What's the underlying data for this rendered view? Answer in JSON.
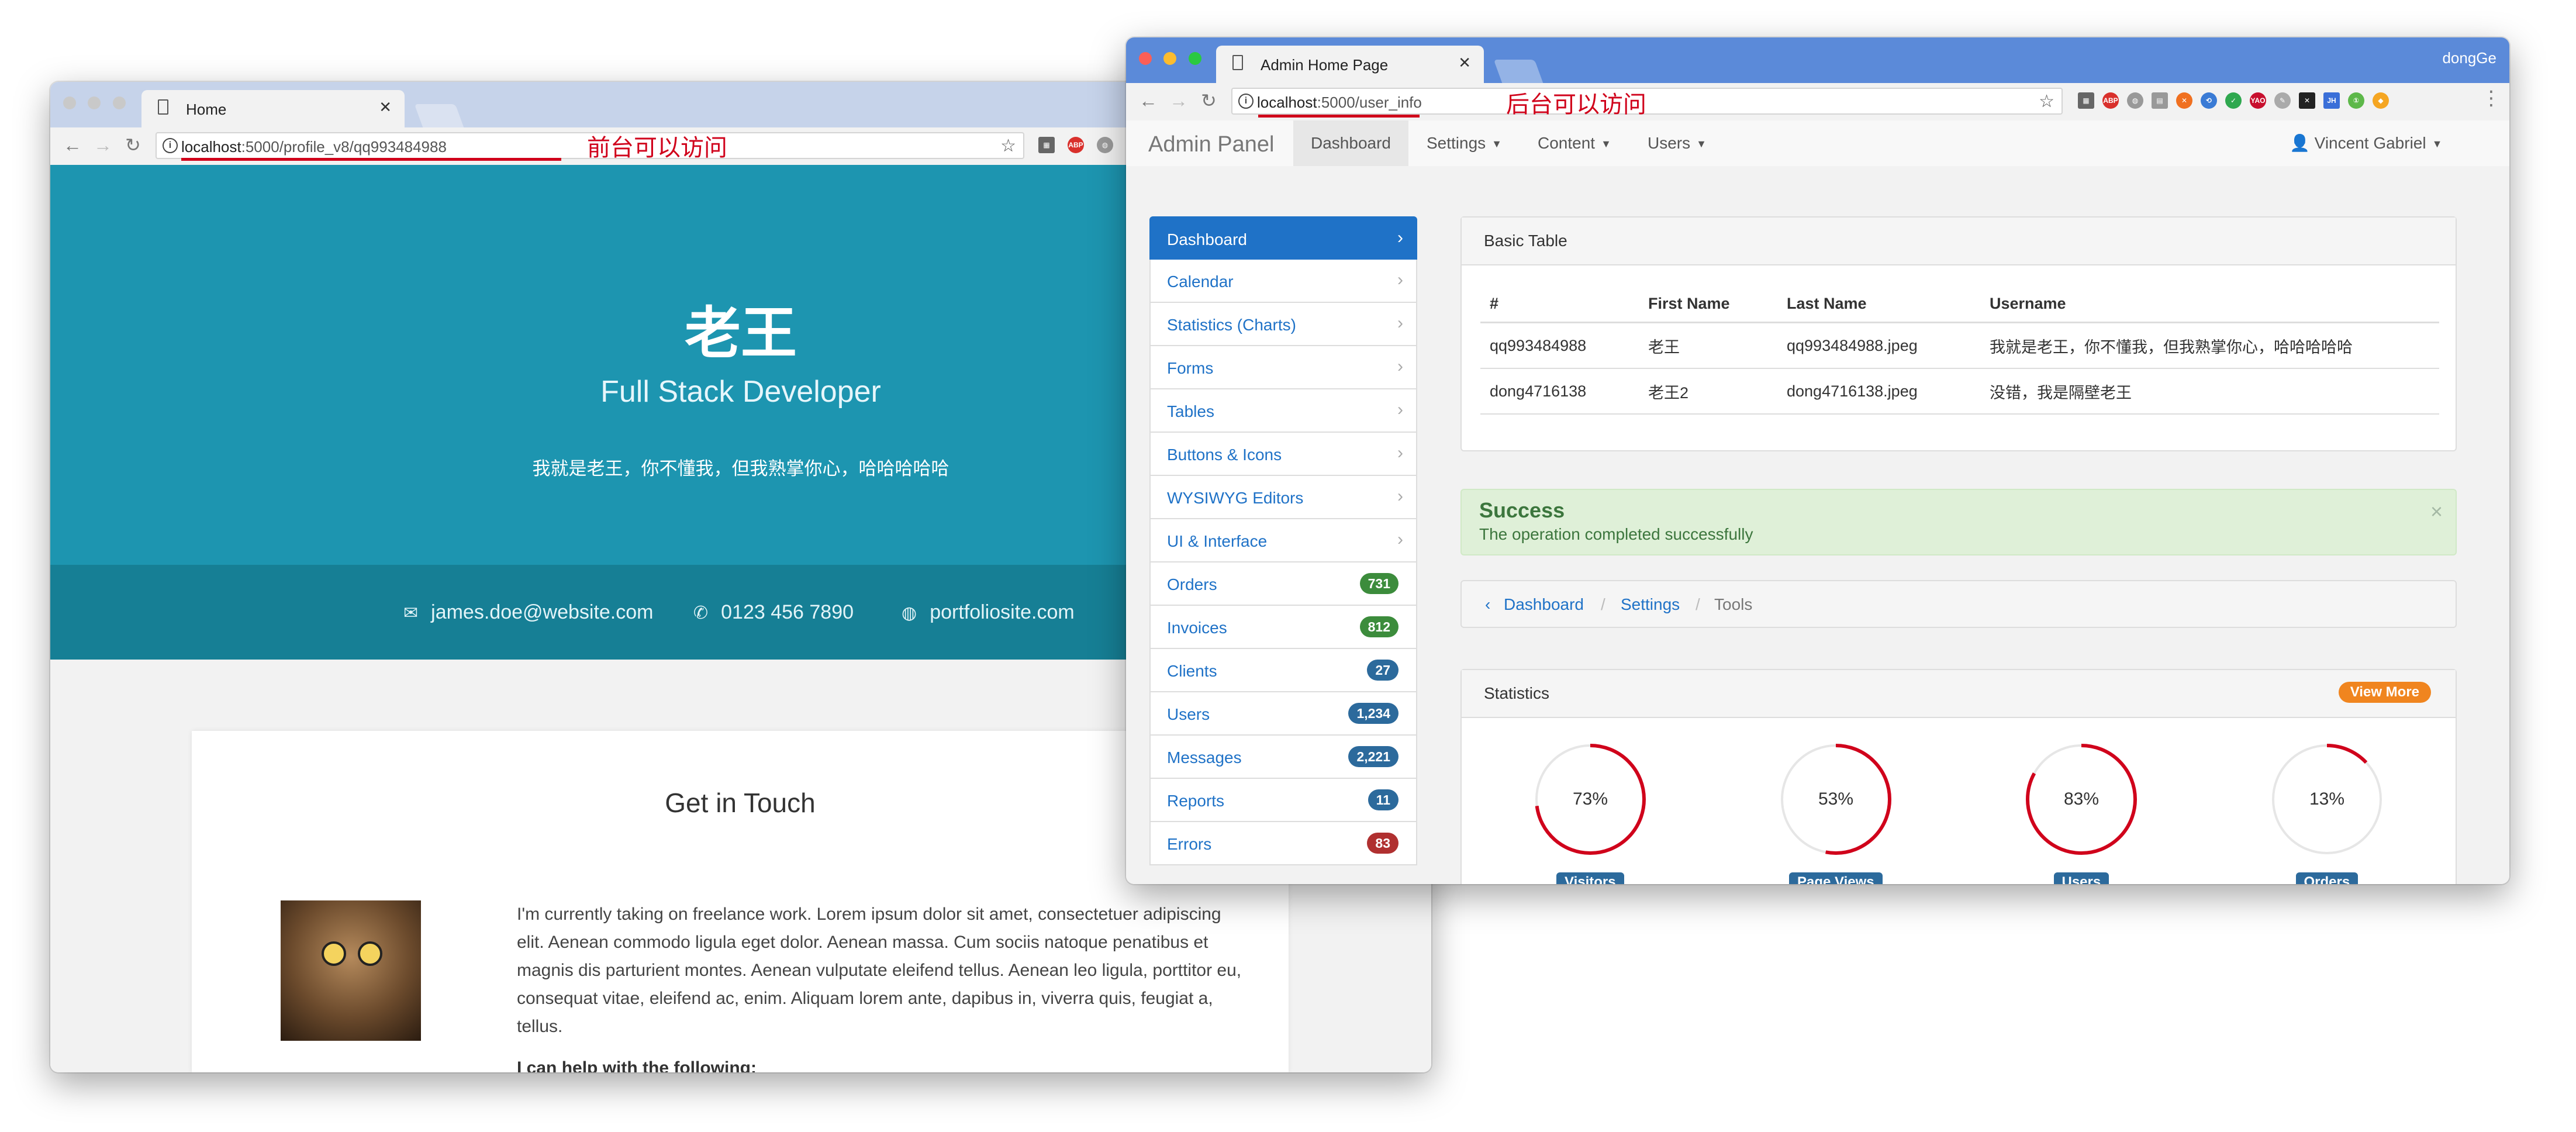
{
  "home_window": {
    "tab_title": "Home",
    "url_host": "localhost",
    "url_path": ":5000/profile_v8/qq993484988",
    "annotation": "前台可以访问",
    "hero": {
      "name": "老王",
      "role": "Full Stack Developer",
      "bio": "我就是老王，你不懂我，但我熟掌你心，哈哈哈哈哈"
    },
    "contact": {
      "email": "james.doe@website.com",
      "phone": "0123 456 7890",
      "site": "portfoliosite.com"
    },
    "touch": {
      "title": "Get in Touch",
      "paragraph": "I'm currently taking on freelance work. Lorem ipsum dolor sit amet, consectetuer adipiscing elit. Aenean commodo ligula eget dolor. Aenean massa. Cum sociis natoque penatibus et magnis dis parturient montes. Aenean vulputate eleifend tellus. Aenean leo ligula, porttitor eu, consequat vitae, eleifend ac, enim. Aliquam lorem ante, dapibus in, viverra quis, feugiat a, tellus.",
      "help_heading": "I can help with the following:"
    }
  },
  "admin_window": {
    "tab_title": "Admin Home Page",
    "profile_name": "dongGe",
    "url_host": "localhost",
    "url_path": ":5000/user_info",
    "annotation": "后台可以访问",
    "navbar": {
      "brand": "Admin Panel",
      "items": [
        "Dashboard",
        "Settings",
        "Content",
        "Users"
      ],
      "user": "Vincent Gabriel"
    },
    "sidebar": [
      {
        "label": "Dashboard",
        "active": true
      },
      {
        "label": "Calendar"
      },
      {
        "label": "Statistics (Charts)"
      },
      {
        "label": "Forms"
      },
      {
        "label": "Tables"
      },
      {
        "label": "Buttons & Icons"
      },
      {
        "label": "WYSIWYG Editors"
      },
      {
        "label": "UI & Interface"
      },
      {
        "label": "Orders",
        "badge": "731",
        "badge_color": "#3c8c3c"
      },
      {
        "label": "Invoices",
        "badge": "812",
        "badge_color": "#3c8c3c"
      },
      {
        "label": "Clients",
        "badge": "27",
        "badge_color": "#2c6a9c"
      },
      {
        "label": "Users",
        "badge": "1,234",
        "badge_color": "#2c6a9c"
      },
      {
        "label": "Messages",
        "badge": "2,221",
        "badge_color": "#2c6a9c"
      },
      {
        "label": "Reports",
        "badge": "11",
        "badge_color": "#2c6a9c"
      },
      {
        "label": "Errors",
        "badge": "83",
        "badge_color": "#b03030"
      }
    ],
    "basic_table": {
      "title": "Basic Table",
      "headers": [
        "#",
        "First Name",
        "Last Name",
        "Username"
      ],
      "rows": [
        [
          "qq993484988",
          "老王",
          "qq993484988.jpeg",
          "我就是老王，你不懂我，但我熟掌你心，哈哈哈哈哈"
        ],
        [
          "dong4716138",
          "老王2",
          "dong4716138.jpeg",
          "没错，我是隔壁老王"
        ]
      ]
    },
    "alert": {
      "title": "Success",
      "message": "The operation completed successfully",
      "close": "×"
    },
    "breadcrumb": [
      "Dashboard",
      "Settings",
      "Tools"
    ],
    "statistics": {
      "title": "Statistics",
      "view_more": "View More",
      "gauges": [
        {
          "label": "Visitors",
          "value": 73
        },
        {
          "label": "Page Views",
          "value": 53
        },
        {
          "label": "Users",
          "value": 83
        },
        {
          "label": "Orders",
          "value": 13
        }
      ]
    }
  },
  "colors": {
    "hero_bg": "#1d95b0",
    "contact_bg": "#167f95",
    "admin_primary": "#1f72c7",
    "gauge_red": "#d0021b",
    "annotation_red": "#d0021b",
    "success_bg": "#dff0d8"
  }
}
